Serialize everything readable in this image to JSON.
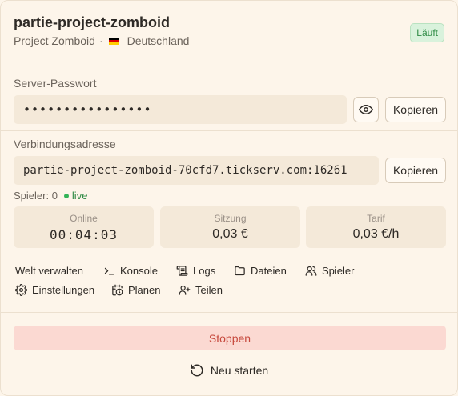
{
  "server": {
    "name": "partie-project-zomboid",
    "game": "Project Zomboid",
    "separator": "·",
    "country": "Deutschland",
    "status": "Läuft"
  },
  "password": {
    "label": "Server-Passwort",
    "value": "••••••••••••••••",
    "copy_label": "Kopieren"
  },
  "address": {
    "label": "Verbindungsadresse",
    "value": "partie-project-zomboid-70cfd7.tickserv.com:16261",
    "copy_label": "Kopieren"
  },
  "players": {
    "label": "Spieler: 0",
    "live": "live"
  },
  "stats": [
    {
      "label": "Online",
      "value": "00:04:03"
    },
    {
      "label": "Sitzung",
      "value": "0,03 €"
    },
    {
      "label": "Tarif",
      "value": "0,03 €/h"
    }
  ],
  "actions": {
    "world": "Welt verwalten",
    "console": "Konsole",
    "logs": "Logs",
    "files": "Dateien",
    "players": "Spieler",
    "settings": "Einstellungen",
    "schedule": "Planen",
    "share": "Teilen"
  },
  "footer": {
    "stop": "Stoppen",
    "restart": "Neu starten"
  },
  "colors": {
    "background": "#fdf5ea",
    "status_green": "#2e8a44",
    "stop_bg": "#fbd9d2",
    "stop_text": "#c6483c"
  }
}
